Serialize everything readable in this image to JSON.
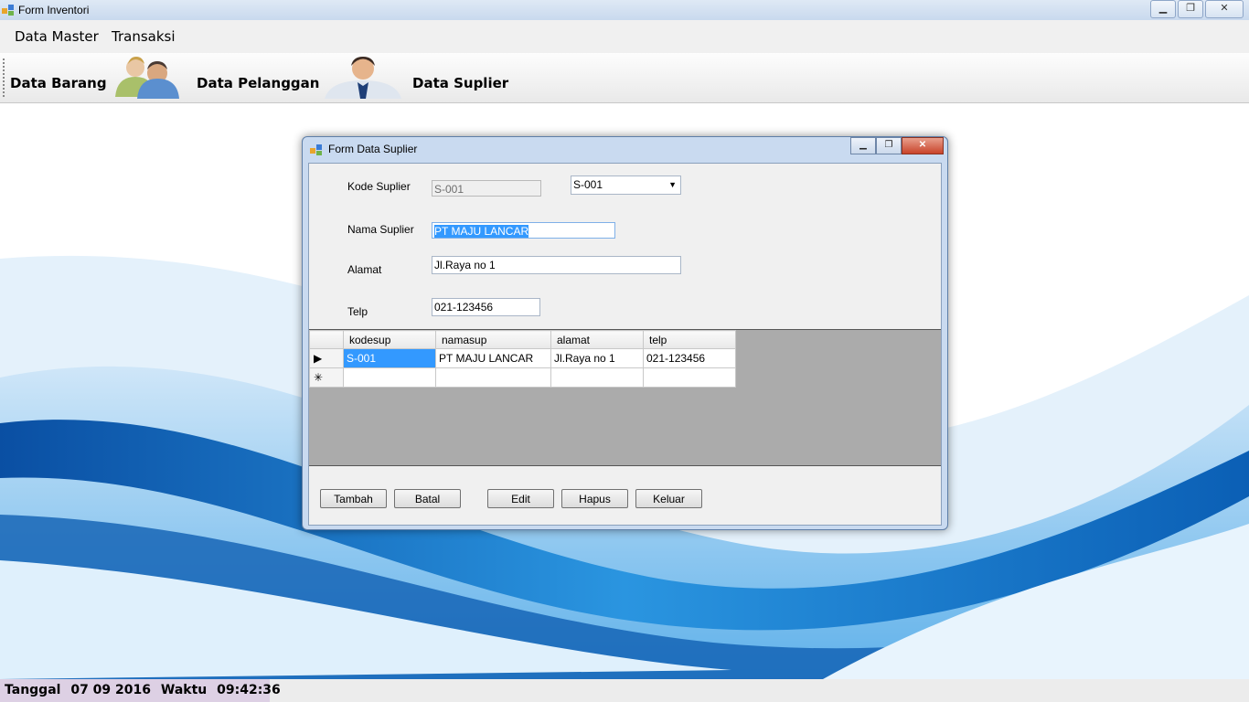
{
  "window": {
    "title": "Form Inventori"
  },
  "menu": {
    "items": [
      "Data Master",
      "Transaksi"
    ]
  },
  "toolbar": {
    "data_barang": "Data Barang",
    "data_pelanggan": "Data Pelanggan",
    "data_suplier": "Data Suplier"
  },
  "status": {
    "tanggal_label": "Tanggal",
    "tanggal_value": "07 09 2016",
    "waktu_label": "Waktu",
    "waktu_value": "09:42:36"
  },
  "dialog": {
    "title": "Form Data Suplier",
    "fields": {
      "kode_label": "Kode Suplier",
      "kode_value": "S-001",
      "kode_combo": "S-001",
      "nama_label": "Nama Suplier",
      "nama_value": "PT MAJU LANCAR",
      "alamat_label": "Alamat",
      "alamat_value": "Jl.Raya no 1",
      "telp_label": "Telp",
      "telp_value": "021-123456"
    },
    "grid": {
      "columns": [
        "kodesup",
        "namasup",
        "alamat",
        "telp"
      ],
      "rows": [
        [
          "S-001",
          "PT MAJU LANCAR",
          "Jl.Raya no 1",
          "021-123456"
        ]
      ]
    },
    "buttons": {
      "tambah": "Tambah",
      "batal": "Batal",
      "edit": "Edit",
      "hapus": "Hapus",
      "keluar": "Keluar"
    }
  },
  "colors": {
    "status_bg": "#ddd0e4",
    "selection": "#3399ff",
    "wave_blue": "#1a7fd0"
  }
}
